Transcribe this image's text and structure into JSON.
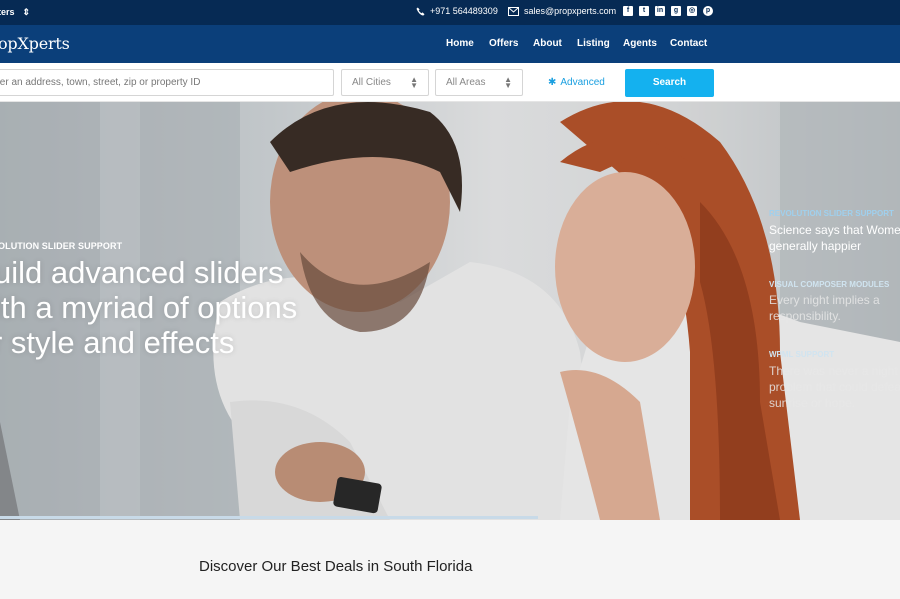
{
  "topbar": {
    "lang_label": "ters",
    "phone": "+971 564489309",
    "email": "sales@propxperts.com",
    "socials": [
      "facebook-icon",
      "twitter-icon",
      "linkedin-icon",
      "google-plus-icon",
      "instagram-icon",
      "pinterest-icon"
    ]
  },
  "nav": {
    "logo": "opXperts",
    "menu": [
      "Home",
      "Offers",
      "About",
      "Listing",
      "Agents",
      "Contact"
    ]
  },
  "search": {
    "placeholder": "ter an address, town, street, zip or property ID",
    "city": "All Cities",
    "area": "All Areas",
    "advanced_label": "Advanced",
    "button_label": "Search"
  },
  "hero": {
    "tag": "OLUTION SLIDER SUPPORT",
    "line1": "uild advanced sliders",
    "line2": "ith a myriad of options",
    "line3": "r style and effects",
    "side": [
      {
        "heading": "REVOLUTION SLIDER SUPPORT",
        "text1": "Science says that Women",
        "text2": "generally happier"
      },
      {
        "heading": "VISUAL COMPOSER MODULES",
        "text1": "Every night implies a",
        "text2": "responsibility."
      },
      {
        "heading": "WPML SUPPORT",
        "text1": "There was never a night o",
        "text2": "problem that could defeat",
        "text3": "sunrise or hope."
      }
    ]
  },
  "deals": {
    "title": "Discover Our Best Deals in South Florida"
  },
  "colors": {
    "topbar": "#062a54",
    "nav": "#0b3f7a",
    "accent": "#14b1ef"
  }
}
